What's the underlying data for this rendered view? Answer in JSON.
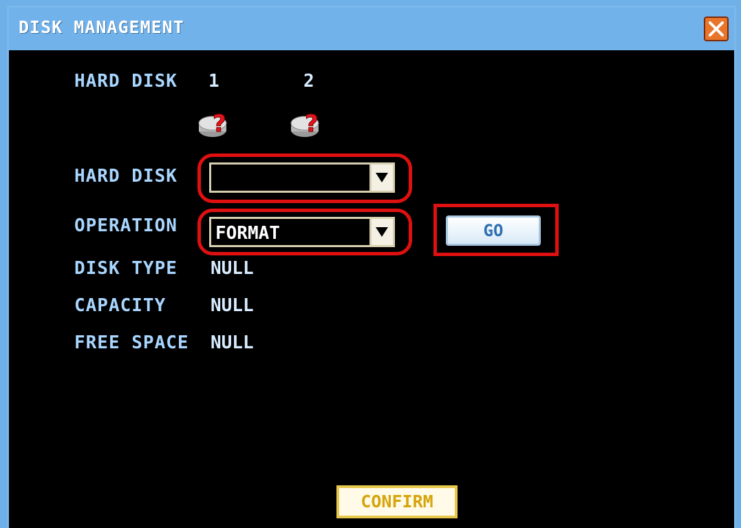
{
  "window": {
    "title": "DISK MANAGEMENT",
    "close_icon": "close-icon"
  },
  "disks": {
    "label": "HARD DISK",
    "items": [
      {
        "number": "1",
        "icon": "hard-disk-unknown-icon"
      },
      {
        "number": "2",
        "icon": "hard-disk-unknown-icon"
      }
    ]
  },
  "form": {
    "hard_disk_label": "HARD DISK",
    "hard_disk_value": "",
    "operation_label": "OPERATION",
    "operation_value": "FORMAT",
    "go_label": "GO",
    "disk_type_label": "DISK TYPE",
    "disk_type_value": "NULL",
    "capacity_label": "CAPACITY",
    "capacity_value": "NULL",
    "free_space_label": "FREE SPACE",
    "free_space_value": "NULL"
  },
  "footer": {
    "confirm_label": "CONFIRM"
  },
  "colors": {
    "titlebar": "#72b2ea",
    "label": "#a9d6ff",
    "highlight": "#e01010",
    "confirm_text": "#d6a50d"
  }
}
